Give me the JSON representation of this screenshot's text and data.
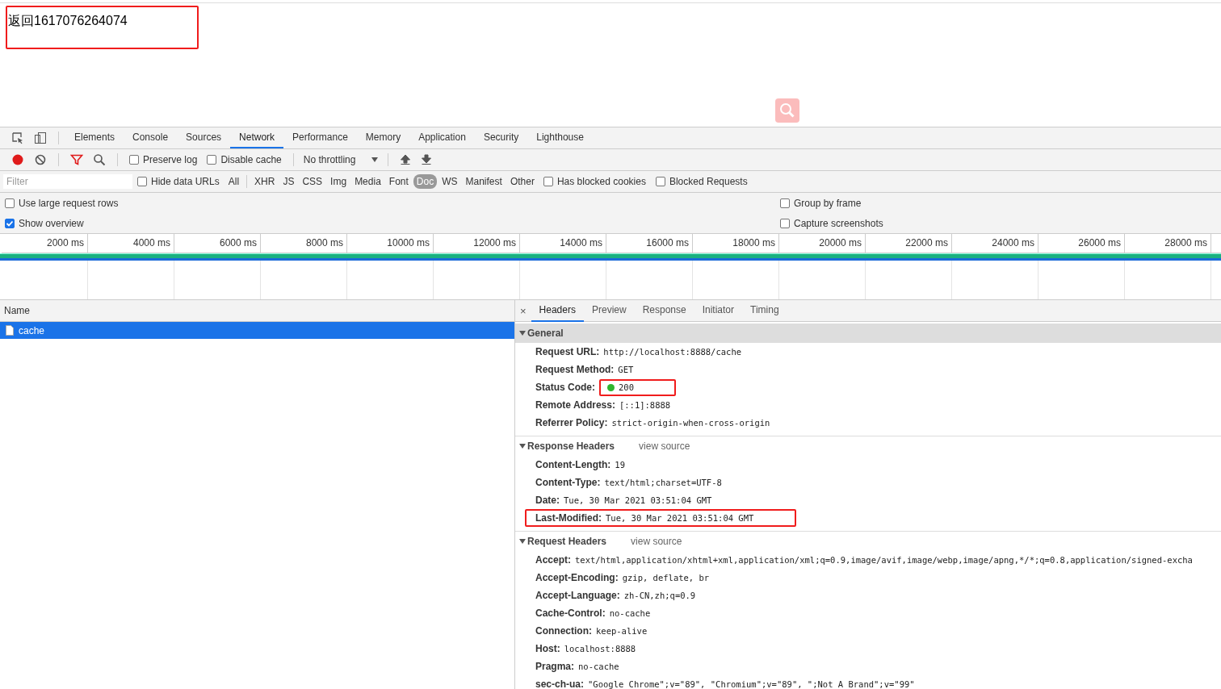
{
  "page": {
    "text": "返回1617076264074",
    "highlighted": true
  },
  "devtools": {
    "tabs": [
      {
        "label": "Elements",
        "selected": false
      },
      {
        "label": "Console",
        "selected": false
      },
      {
        "label": "Sources",
        "selected": false
      },
      {
        "label": "Network",
        "selected": true
      },
      {
        "label": "Performance",
        "selected": false
      },
      {
        "label": "Memory",
        "selected": false
      },
      {
        "label": "Application",
        "selected": false
      },
      {
        "label": "Security",
        "selected": false
      },
      {
        "label": "Lighthouse",
        "selected": false
      }
    ],
    "toolbar": {
      "recording": true,
      "filter_active": true,
      "options": [
        {
          "label": "Preserve log",
          "checked": false
        },
        {
          "label": "Disable cache",
          "checked": false
        }
      ],
      "throttling": "No throttling"
    },
    "filter_bar": {
      "placeholder": "Filter",
      "hide_data_urls": {
        "label": "Hide data URLs",
        "checked": false
      },
      "types": [
        {
          "label": "All",
          "selected": false
        },
        {
          "label": "XHR",
          "selected": false
        },
        {
          "label": "JS",
          "selected": false
        },
        {
          "label": "CSS",
          "selected": false
        },
        {
          "label": "Img",
          "selected": false
        },
        {
          "label": "Media",
          "selected": false
        },
        {
          "label": "Font",
          "selected": false
        },
        {
          "label": "Doc",
          "selected": true
        },
        {
          "label": "WS",
          "selected": false
        },
        {
          "label": "Manifest",
          "selected": false
        },
        {
          "label": "Other",
          "selected": false
        }
      ],
      "options": [
        {
          "label": "Has blocked cookies",
          "checked": false
        },
        {
          "label": "Blocked Requests",
          "checked": false
        }
      ]
    },
    "settings_left": [
      {
        "label": "Use large request rows",
        "checked": false
      },
      {
        "label": "Show overview",
        "checked": true
      }
    ],
    "settings_right": [
      {
        "label": "Group by frame",
        "checked": false
      },
      {
        "label": "Capture screenshots",
        "checked": false
      }
    ],
    "overview_ticks": [
      "2000 ms",
      "4000 ms",
      "6000 ms",
      "8000 ms",
      "10000 ms",
      "12000 ms",
      "14000 ms",
      "16000 ms",
      "18000 ms",
      "20000 ms",
      "22000 ms",
      "24000 ms",
      "26000 ms",
      "28000 ms"
    ],
    "requests": {
      "column": "Name",
      "rows": [
        {
          "name": "cache",
          "selected": true
        }
      ]
    },
    "detail": {
      "close": "×",
      "tabs": [
        {
          "label": "Headers",
          "selected": true
        },
        {
          "label": "Preview",
          "selected": false
        },
        {
          "label": "Response",
          "selected": false
        },
        {
          "label": "Initiator",
          "selected": false
        },
        {
          "label": "Timing",
          "selected": false
        }
      ],
      "sections": [
        {
          "title": "General",
          "expanded": true,
          "rows": [
            {
              "name": "Request URL:",
              "value": "http://localhost:8888/cache"
            },
            {
              "name": "Request Method:",
              "value": "GET"
            },
            {
              "name": "Status Code:",
              "value": "200",
              "status_dot": true,
              "value_highlighted": true
            },
            {
              "name": "Remote Address:",
              "value": "[::1]:8888"
            },
            {
              "name": "Referrer Policy:",
              "value": "strict-origin-when-cross-origin"
            }
          ]
        },
        {
          "title": "Response Headers",
          "expanded": true,
          "link": "view source",
          "rows": [
            {
              "name": "Content-Length:",
              "value": "19"
            },
            {
              "name": "Content-Type:",
              "value": "text/html;charset=UTF-8"
            },
            {
              "name": "Date:",
              "value": "Tue, 30 Mar 2021 03:51:04 GMT"
            },
            {
              "name": "Last-Modified:",
              "value": "Tue, 30 Mar 2021 03:51:04 GMT",
              "row_highlighted": true
            }
          ]
        },
        {
          "title": "Request Headers",
          "expanded": true,
          "link": "view source",
          "rows": [
            {
              "name": "Accept:",
              "value": "text/html,application/xhtml+xml,application/xml;q=0.9,image/avif,image/webp,image/apng,*/*;q=0.8,application/signed-excha"
            },
            {
              "name": "Accept-Encoding:",
              "value": "gzip, deflate, br"
            },
            {
              "name": "Accept-Language:",
              "value": "zh-CN,zh;q=0.9"
            },
            {
              "name": "Cache-Control:",
              "value": "no-cache"
            },
            {
              "name": "Connection:",
              "value": "keep-alive"
            },
            {
              "name": "Host:",
              "value": "localhost:8888"
            },
            {
              "name": "Pragma:",
              "value": "no-cache"
            },
            {
              "name": "sec-ch-ua:",
              "value": "\"Google Chrome\";v=\"89\", \"Chromium\";v=\"89\", \";Not A Brand\";v=\"99\""
            }
          ]
        }
      ]
    }
  }
}
